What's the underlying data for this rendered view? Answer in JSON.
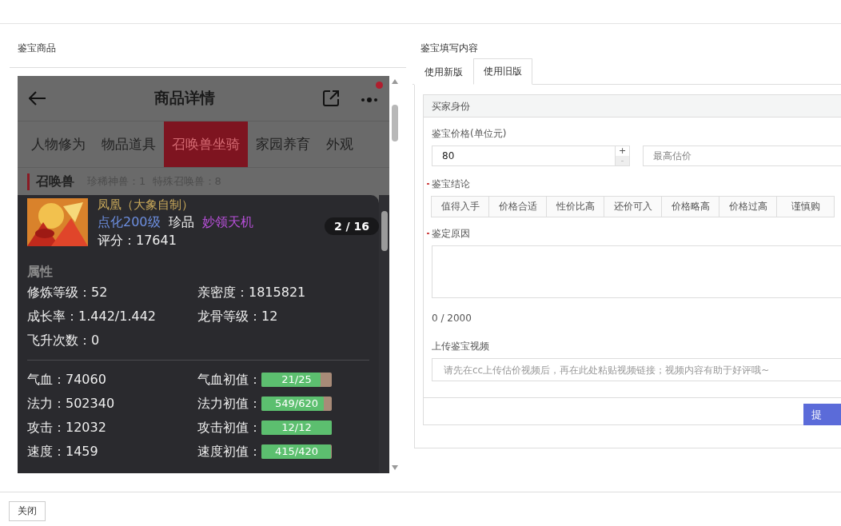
{
  "left_panel": {
    "title": "鉴宝商品"
  },
  "phone": {
    "title": "商品详情",
    "has_notification": true,
    "tabs": [
      {
        "label": "人物修为",
        "selected": false
      },
      {
        "label": "物品道具",
        "selected": false
      },
      {
        "label": "召唤兽坐骑",
        "selected": true
      },
      {
        "label": "家园养育",
        "selected": false
      },
      {
        "label": "外观",
        "selected": false
      }
    ],
    "section": {
      "title": "召唤兽",
      "stats": "珍稀神兽：1  特殊召唤兽：8"
    },
    "card": {
      "name": "凤凰（大象自制）",
      "tags": [
        {
          "label": "点化200级",
          "color": "#6d8fe0"
        },
        {
          "label": "珍品",
          "color": "#f2f2f2"
        },
        {
          "label": "妙领天机",
          "color": "#b54fd6"
        }
      ],
      "score": "评分：17641",
      "pager": "2 / 16",
      "attr_heading": "属性",
      "attributes": [
        "修炼等级：52",
        "亲密度：1815821",
        "成长率：1.442/1.442",
        "龙骨等级：12",
        "飞升次数：0"
      ],
      "stats": [
        {
          "label": "气血：74060",
          "bar_label": "气血初值：",
          "reading": "21/25",
          "level": 0.84
        },
        {
          "label": "法力：502340",
          "bar_label": "法力初值：",
          "reading": "549/620",
          "level": 0.885
        },
        {
          "label": "攻击：12032",
          "bar_label": "攻击初值：",
          "reading": "12/12",
          "level": 1
        },
        {
          "label": "速度：1459",
          "bar_label": "速度初值：",
          "reading": "415/420",
          "level": 0.988
        }
      ]
    }
  },
  "right_panel": {
    "title": "鉴宝填写内容",
    "tabs": [
      {
        "label": "使用新版",
        "selected": false
      },
      {
        "label": "使用旧版",
        "selected": true
      }
    ],
    "form": {
      "section_title": "买家身份",
      "price_label": "鉴宝价格(单位元)",
      "price_value": "80",
      "max_price_placeholder": "最高估价",
      "plus": "+",
      "minus": "-",
      "conclusion_label": "鉴宝结论",
      "conclusion_required": true,
      "conclusions": [
        {
          "label": "值得入手",
          "selected": false
        },
        {
          "label": "价格合适",
          "selected": false
        },
        {
          "label": "性价比高",
          "selected": false
        },
        {
          "label": "还价可入",
          "selected": false
        },
        {
          "label": "价格略高",
          "selected": false
        },
        {
          "label": "价格过高",
          "selected": false
        },
        {
          "label": "谨慎购",
          "selected": false
        }
      ],
      "reason_label": "鉴定原因",
      "reason_required": true,
      "counter": "0 / 2000",
      "video_label": "上传鉴宝视频",
      "video_placeholder": "请先在cc上传估价视频后，再在此处粘贴视频链接；视频内容有助于好评哦~",
      "submit": "提"
    }
  },
  "footer": {
    "close": "关闭"
  }
}
